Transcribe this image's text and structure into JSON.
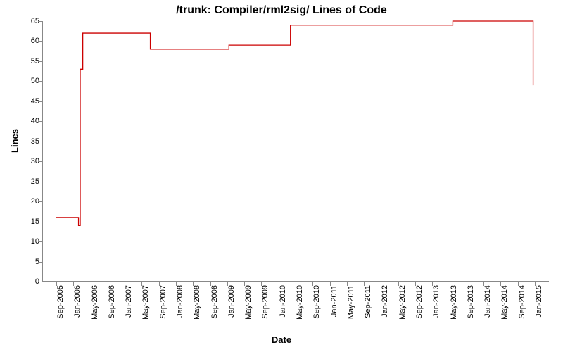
{
  "chart_data": {
    "type": "line",
    "title": "/trunk: Compiler/rml2sig/ Lines of Code",
    "xlabel": "Date",
    "ylabel": "Lines",
    "ylim": [
      0,
      65
    ],
    "yticks": [
      0,
      5,
      10,
      15,
      20,
      25,
      30,
      35,
      40,
      45,
      50,
      55,
      60,
      65
    ],
    "x_categories": [
      "Sep-2005",
      "Jan-2006",
      "May-2006",
      "Sep-2006",
      "Jan-2007",
      "May-2007",
      "Sep-2007",
      "Jan-2008",
      "May-2008",
      "Sep-2008",
      "Jan-2009",
      "May-2009",
      "Sep-2009",
      "Jan-2010",
      "May-2010",
      "Sep-2010",
      "Jan-2011",
      "May-2011",
      "Sep-2011",
      "Jan-2012",
      "May-2012",
      "Sep-2012",
      "Jan-2013",
      "May-2013",
      "Sep-2013",
      "Jan-2014",
      "May-2014",
      "Sep-2014",
      "Jan-2015"
    ],
    "series": [
      {
        "name": "Lines of Code",
        "color": "#cc0000",
        "points": [
          {
            "x": 0.0,
            "y": 16
          },
          {
            "x": 1.3,
            "y": 16
          },
          {
            "x": 1.3,
            "y": 14
          },
          {
            "x": 1.4,
            "y": 14
          },
          {
            "x": 1.4,
            "y": 53
          },
          {
            "x": 1.55,
            "y": 53
          },
          {
            "x": 1.55,
            "y": 62
          },
          {
            "x": 5.5,
            "y": 62
          },
          {
            "x": 5.5,
            "y": 58
          },
          {
            "x": 10.1,
            "y": 58
          },
          {
            "x": 10.1,
            "y": 59
          },
          {
            "x": 13.7,
            "y": 59
          },
          {
            "x": 13.7,
            "y": 64
          },
          {
            "x": 23.2,
            "y": 64
          },
          {
            "x": 23.2,
            "y": 65
          },
          {
            "x": 27.9,
            "y": 65
          },
          {
            "x": 27.9,
            "y": 49
          }
        ]
      }
    ]
  }
}
